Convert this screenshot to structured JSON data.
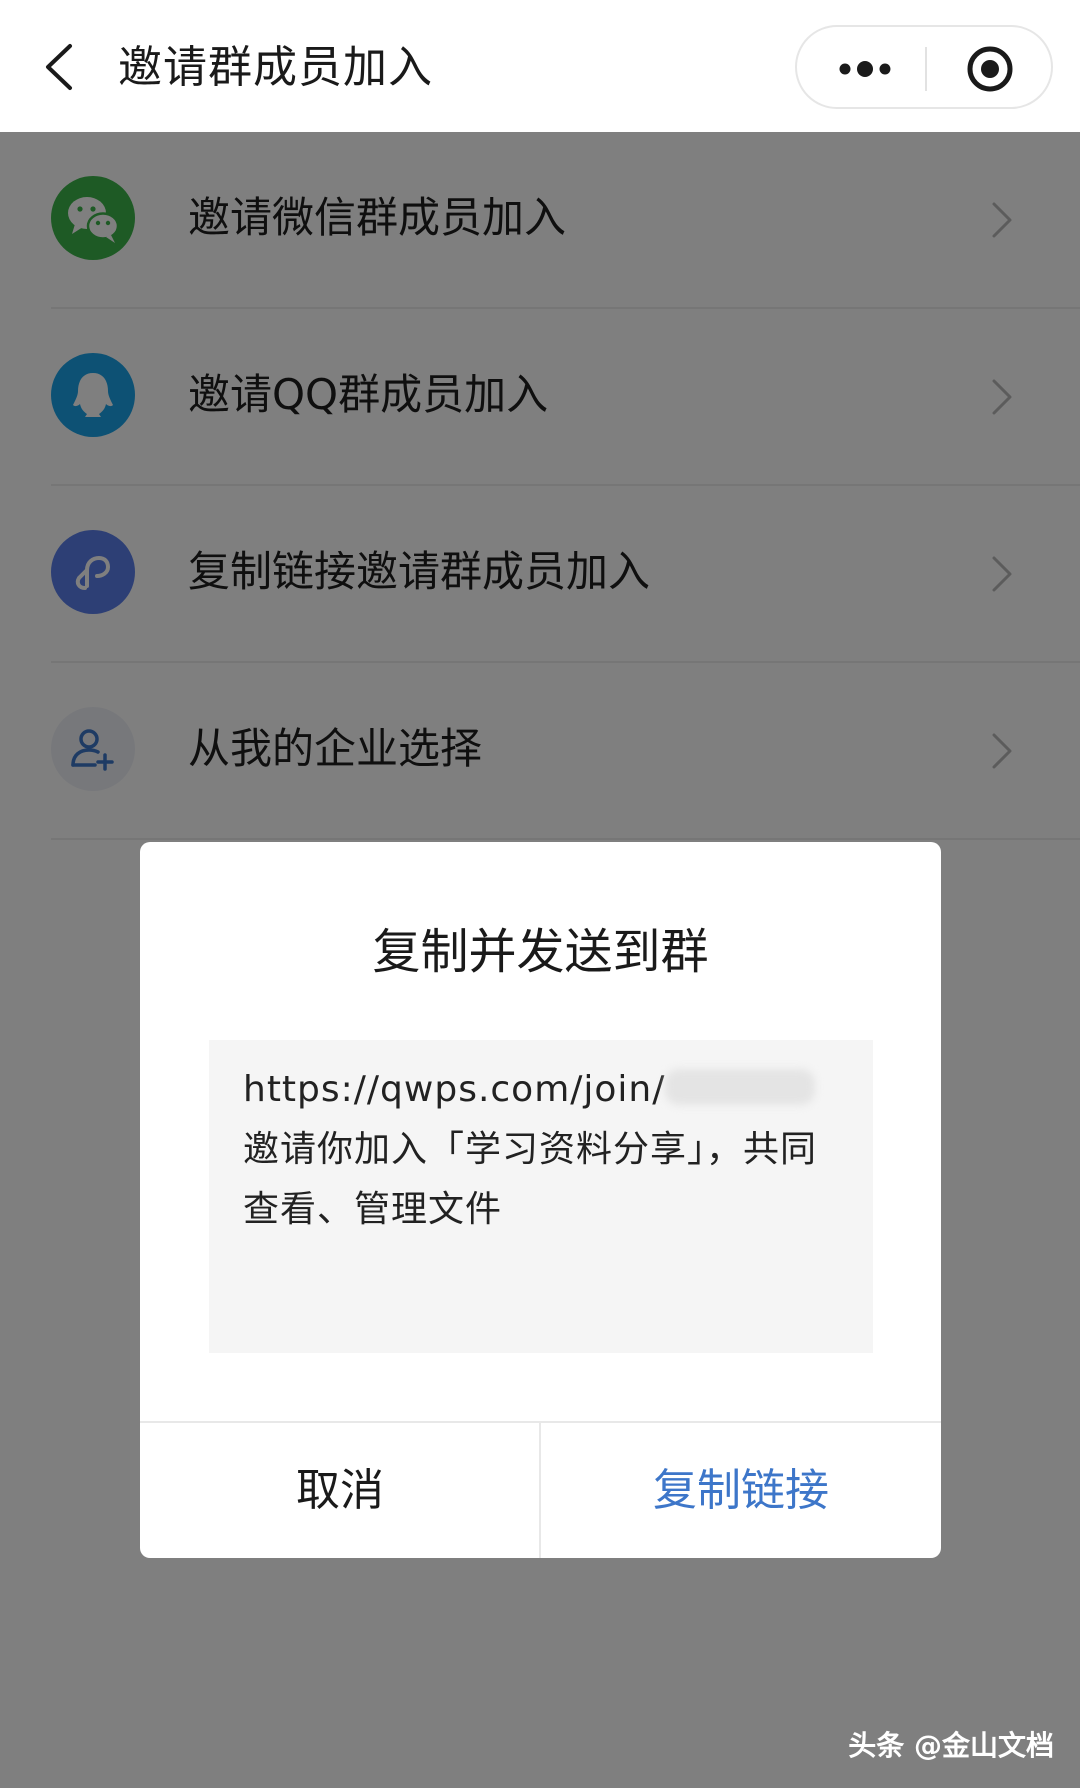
{
  "header": {
    "title": "邀请群成员加入"
  },
  "list": {
    "items": [
      {
        "label": "邀请微信群成员加入",
        "icon": "wechat-icon",
        "color": "#3cb54a"
      },
      {
        "label": "邀请QQ群成员加入",
        "icon": "qq-icon",
        "color": "#1aa3e8"
      },
      {
        "label": "复制链接邀请群成员加入",
        "icon": "link-icon",
        "color": "#5b7fea"
      },
      {
        "label": "从我的企业选择",
        "icon": "add-person-icon",
        "color": "#eef1f7"
      }
    ]
  },
  "dialog": {
    "title": "复制并发送到群",
    "link_text": "https://qwps.com/join/",
    "message": "邀请你加入「学习资料分享」，共同查看、管理文件",
    "cancel_label": "取消",
    "copy_label": "复制链接"
  },
  "watermark": "头条 @金山文档",
  "colors": {
    "accent": "#3d76c9",
    "overlay": "rgba(0,0,0,0.5)"
  }
}
